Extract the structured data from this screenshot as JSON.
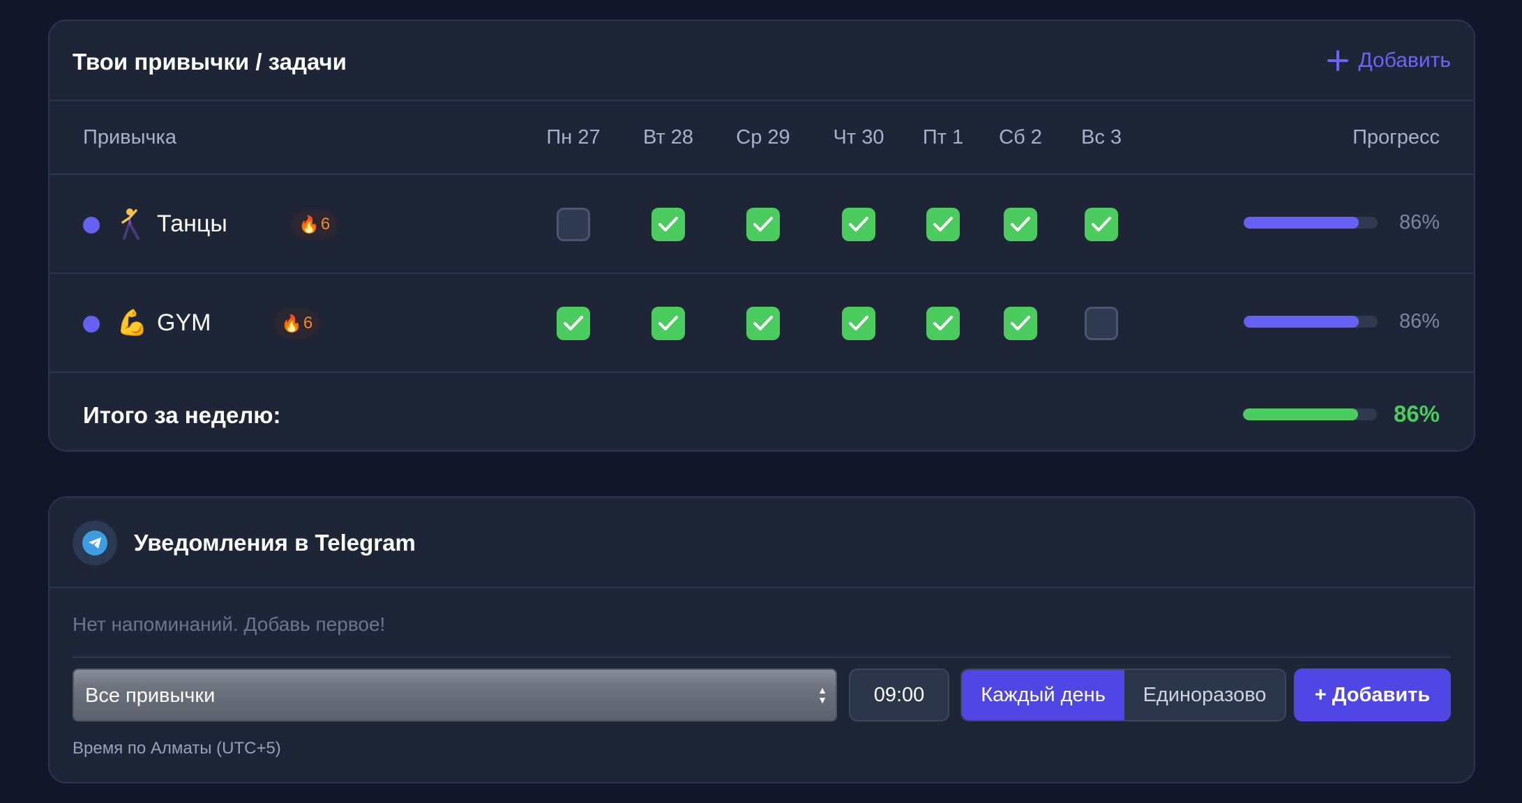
{
  "habits_card": {
    "title": "Твои привычки / задачи",
    "add_label": "Добавить",
    "columns": {
      "habit": "Привычка",
      "days": [
        "Пн 27",
        "Вт 28",
        "Ср 29",
        "Чт 30",
        "Пт 1",
        "Сб 2",
        "Вс 3"
      ],
      "progress": "Прогресс"
    },
    "rows": [
      {
        "emoji": "🕺",
        "name": "Танцы",
        "streak_icon": "🔥",
        "streak": "6",
        "checks": [
          false,
          true,
          true,
          true,
          true,
          true,
          true
        ],
        "progress_fraction": 0.86,
        "progress_label": "86%"
      },
      {
        "emoji": "💪",
        "name": "GYM",
        "streak_icon": "🔥",
        "streak": "6",
        "checks": [
          true,
          true,
          true,
          true,
          true,
          true,
          false
        ],
        "progress_fraction": 0.86,
        "progress_label": "86%"
      }
    ],
    "total": {
      "label": "Итого за неделю:",
      "progress_fraction": 0.86,
      "progress_label": "86%"
    }
  },
  "notifications_card": {
    "title": "Уведомления в Telegram",
    "empty_text": "Нет напоминаний. Добавь первое!",
    "habit_select": {
      "value": "Все привычки"
    },
    "time_value": "09:00",
    "frequency": {
      "options": [
        "Каждый день",
        "Единоразово"
      ],
      "selected": "Каждый день"
    },
    "submit_label": "+ Добавить",
    "timezone_note": "Время по Алматы (UTC+5)"
  },
  "colors": {
    "background": "#111729",
    "card": "#1d2537",
    "accent": "#4f46e5",
    "habit_dot": "#6661f3",
    "checked": "#4ccb5e",
    "streak": "#f08a2f",
    "total_progress": "#4ccb5e"
  },
  "icons": {
    "add": "plus-icon",
    "check": "checkmark-icon",
    "streak": "flame-icon",
    "telegram": "telegram-icon",
    "select": "select-arrows-icon"
  }
}
